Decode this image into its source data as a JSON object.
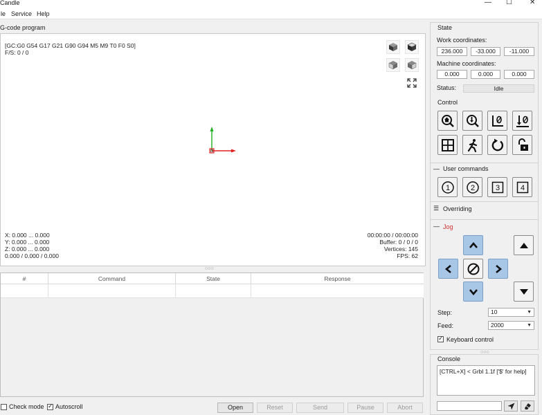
{
  "window": {
    "title": "Candle",
    "min_glyph": "—",
    "max_glyph": "☐",
    "close_glyph": "✕"
  },
  "menu": {
    "items": [
      {
        "label": "le"
      },
      {
        "label": "Service"
      },
      {
        "label": "Help"
      }
    ]
  },
  "program": {
    "group_title": "G-code program",
    "gc_state": "[GC:G0 G54 G17 G21 G90 G94 M5 M9 T0 F0 S0]",
    "feed_speed": "F/S: 0 / 0",
    "coords": {
      "x": "X: 0.000 ... 0.000",
      "y": "Y: 0.000 ... 0.000",
      "z": "Z: 0.000 ... 0.000",
      "totals": "0.000 / 0.000 / 0.000"
    },
    "stats": {
      "time": "00:00:00 / 00:00:00",
      "buffer": "Buffer: 0 / 0 / 0",
      "vertices": "Vertices: 145",
      "fps": "FPS: 62"
    },
    "view_buttons": [
      "view-iso-icon",
      "view-top-icon",
      "view-front-icon",
      "view-left-icon",
      "fit-view-icon"
    ],
    "splitter": "○○○"
  },
  "table": {
    "columns": [
      "#",
      "Command",
      "State",
      "Response"
    ]
  },
  "bottom": {
    "check_mode": {
      "label": "Check mode",
      "checked": false
    },
    "autoscroll": {
      "label": "Autoscroll",
      "checked": true
    },
    "buttons": {
      "open": "Open",
      "reset": "Reset",
      "send": "Send",
      "pause": "Pause",
      "abort": "Abort"
    }
  },
  "state": {
    "title": "State",
    "work_label": "Work coordinates:",
    "work": [
      "236.000",
      "-33.000",
      "-11.000"
    ],
    "machine_label": "Machine coordinates:",
    "machine": [
      "0.000",
      "0.000",
      "0.000"
    ],
    "status_label": "Status:",
    "status_value": "Idle"
  },
  "control": {
    "title": "Control",
    "buttons": [
      "home-icon",
      "probe-icon",
      "zero-xy-icon",
      "zero-z-icon",
      "restore-origin-icon",
      "safe-position-icon",
      "reset-icon",
      "unlock-icon"
    ]
  },
  "user_commands": {
    "collapse_glyph": "—",
    "title": "User commands",
    "buttons": [
      "1",
      "2",
      "3",
      "4"
    ]
  },
  "overriding": {
    "menu_glyph": "☰",
    "title": "Overriding"
  },
  "jog": {
    "collapse_glyph": "—",
    "title": "Jog",
    "title_color": "#d03030",
    "step_label": "Step:",
    "step_value": "10",
    "feed_label": "Feed:",
    "feed_value": "2000",
    "keyboard_control": {
      "label": "Keyboard control",
      "checked": true
    },
    "splitter": "○○○"
  },
  "console": {
    "title": "Console",
    "output": "[CTRL+X] < Grbl 1.1f ['$' for help]",
    "send_icon": "send-icon",
    "clear_icon": "clear-icon"
  },
  "colors": {
    "jog_blue": "#a8c6e6",
    "axis_x": "#e02020",
    "axis_y": "#20b020"
  }
}
